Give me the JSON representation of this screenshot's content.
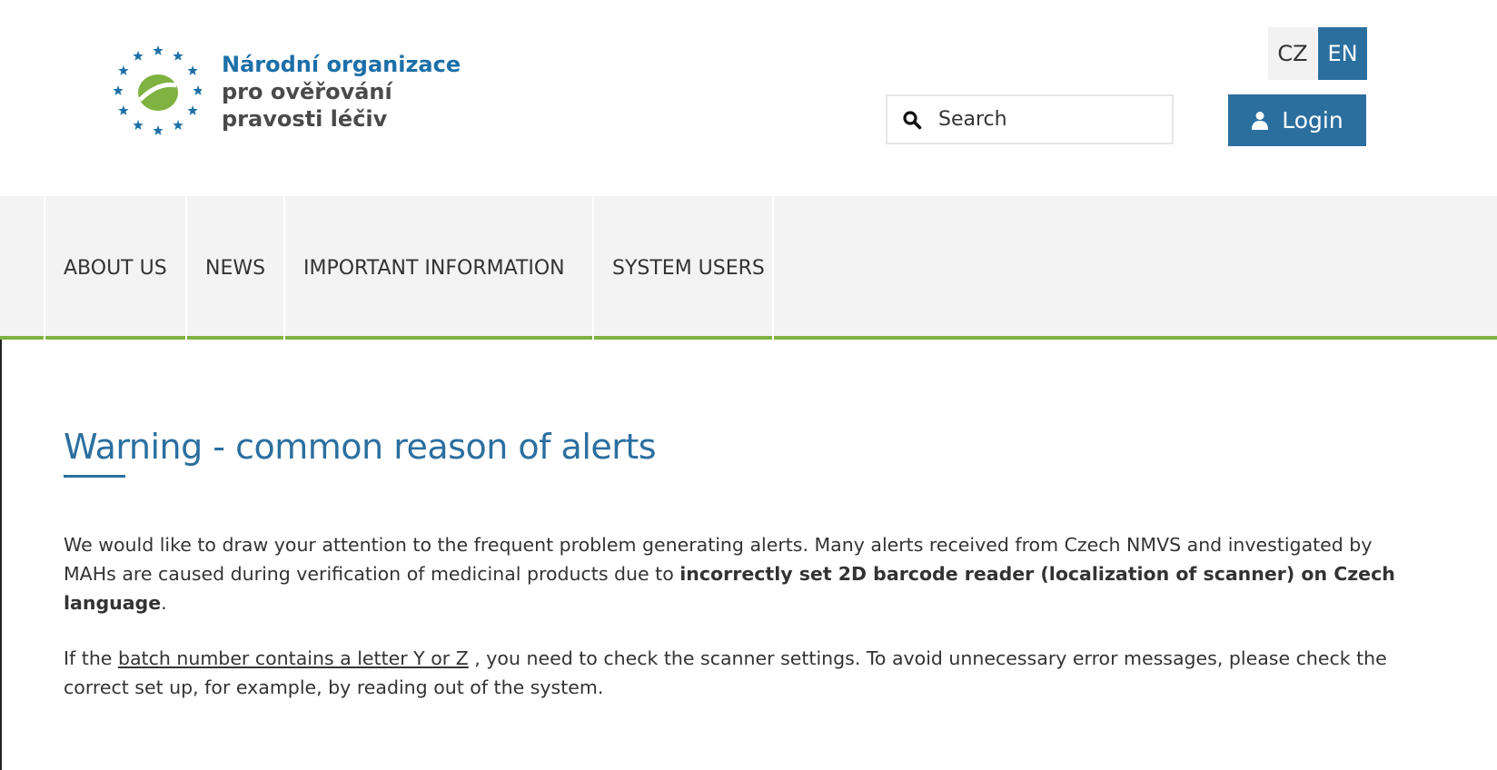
{
  "brand": {
    "line1": "Národní organizace",
    "line2": "pro ověřování",
    "line3": "pravosti léčiv",
    "primary_color": "#2b6f9f",
    "accent_color": "#7fb241"
  },
  "languages": {
    "cz": "CZ",
    "en": "EN",
    "active": "EN"
  },
  "search": {
    "placeholder": "Search",
    "icon": "search-icon"
  },
  "login": {
    "label": "Login",
    "icon": "user-icon"
  },
  "nav": {
    "items": [
      {
        "label": "ABOUT US"
      },
      {
        "label": "NEWS"
      },
      {
        "label": "IMPORTANT INFORMATION"
      },
      {
        "label": "SYSTEM USERS"
      }
    ]
  },
  "article": {
    "title": "Warning - common reason of alerts",
    "p1_text": "We would like to draw your attention to the frequent problem generating alerts. Many alerts received from Czech NMVS and investigated by MAHs are caused during verification of medicinal products due to ",
    "p1_bold": "incorrectly set 2D barcode reader (localization of scanner) on Czech language",
    "p1_end": ".",
    "p2_start": "If the ",
    "p2_link": "batch number contains a letter Y or Z",
    "p2_text": " , you need to check the scanner settings. To avoid unnecessary error messages, please check the correct set up, for example, by reading out of the system."
  }
}
